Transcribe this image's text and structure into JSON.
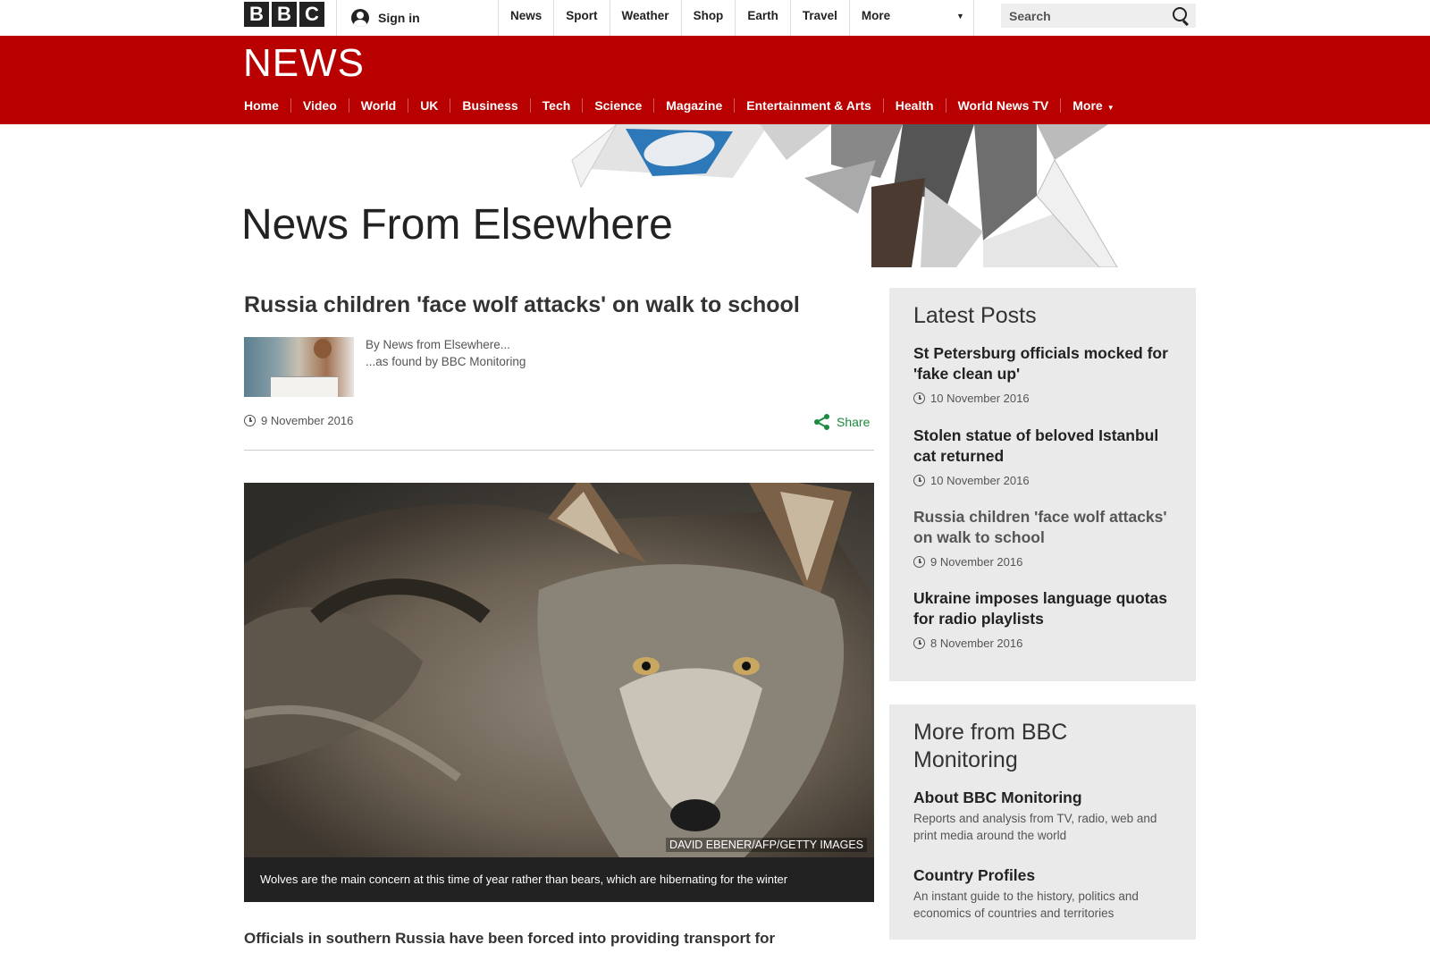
{
  "topbar": {
    "logo_letters": [
      "B",
      "B",
      "C"
    ],
    "signin_label": "Sign in",
    "nav": [
      "News",
      "Sport",
      "Weather",
      "Shop",
      "Earth",
      "Travel"
    ],
    "more_label": "More",
    "search_placeholder": "Search"
  },
  "header": {
    "logo": "NEWS",
    "nav": [
      "Home",
      "Video",
      "World",
      "UK",
      "Business",
      "Tech",
      "Science",
      "Magazine",
      "Entertainment & Arts",
      "Health",
      "World News TV"
    ],
    "more_label": "More"
  },
  "banner": {
    "title": "News From Elsewhere"
  },
  "article": {
    "headline": "Russia children 'face wolf attacks' on walk to school",
    "byline": "By News from Elsewhere...",
    "found_by": "...as found by BBC Monitoring",
    "date": "9 November 2016",
    "share_label": "Share",
    "image_credit": "DAVID EBENER/AFP/GETTY IMAGES",
    "image_caption": "Wolves are the main concern at this time of year rather than bears, which are hibernating for the winter",
    "body_start": "Officials in southern Russia have been forced into providing transport for"
  },
  "sidebar": {
    "latest_title": "Latest Posts",
    "posts": [
      {
        "title": "St Petersburg officials mocked for 'fake clean up'",
        "date": "10 November 2016"
      },
      {
        "title": "Stolen statue of beloved Istanbul cat returned",
        "date": "10 November 2016"
      },
      {
        "title": "Russia children 'face wolf attacks' on walk to school",
        "date": "9 November 2016"
      },
      {
        "title": "Ukraine imposes language quotas for radio playlists",
        "date": "8 November 2016"
      }
    ],
    "more_title": "More from BBC Monitoring",
    "more_items": [
      {
        "title": "About BBC Monitoring",
        "desc": "Reports and analysis from TV, radio, web and print media around the world"
      },
      {
        "title": "Country Profiles",
        "desc": "An instant guide to the history, politics and economics of countries and territories"
      }
    ]
  },
  "colors": {
    "brand_red": "#b80000",
    "share_green": "#1a8a3e",
    "panel_bg": "#eaeaea"
  }
}
